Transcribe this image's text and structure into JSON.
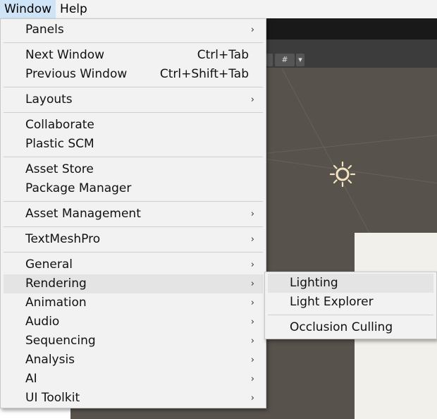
{
  "menubar": {
    "items": [
      {
        "label": "Window",
        "active": true
      },
      {
        "label": "Help",
        "active": false
      }
    ]
  },
  "window_menu": {
    "groups": [
      [
        {
          "label": "Panels",
          "submenu": true
        }
      ],
      [
        {
          "label": "Next Window",
          "shortcut": "Ctrl+Tab"
        },
        {
          "label": "Previous Window",
          "shortcut": "Ctrl+Shift+Tab"
        }
      ],
      [
        {
          "label": "Layouts",
          "submenu": true
        }
      ],
      [
        {
          "label": "Collaborate"
        },
        {
          "label": "Plastic SCM"
        }
      ],
      [
        {
          "label": "Asset Store"
        },
        {
          "label": "Package Manager"
        }
      ],
      [
        {
          "label": "Asset Management",
          "submenu": true
        }
      ],
      [
        {
          "label": "TextMeshPro",
          "submenu": true
        }
      ],
      [
        {
          "label": "General",
          "submenu": true
        },
        {
          "label": "Rendering",
          "submenu": true,
          "highlighted": true
        },
        {
          "label": "Animation",
          "submenu": true
        },
        {
          "label": "Audio",
          "submenu": true
        },
        {
          "label": "Sequencing",
          "submenu": true
        },
        {
          "label": "Analysis",
          "submenu": true
        },
        {
          "label": "AI",
          "submenu": true
        },
        {
          "label": "UI Toolkit",
          "submenu": true
        }
      ]
    ]
  },
  "rendering_submenu": {
    "groups": [
      [
        {
          "label": "Lighting",
          "highlighted": true
        },
        {
          "label": "Light Explorer"
        }
      ],
      [
        {
          "label": "Occlusion Culling"
        }
      ]
    ]
  },
  "scene": {
    "background_color": "#58524c",
    "light_icon": "sun-icon",
    "toolbar_grid_icon": "grid-icon"
  }
}
